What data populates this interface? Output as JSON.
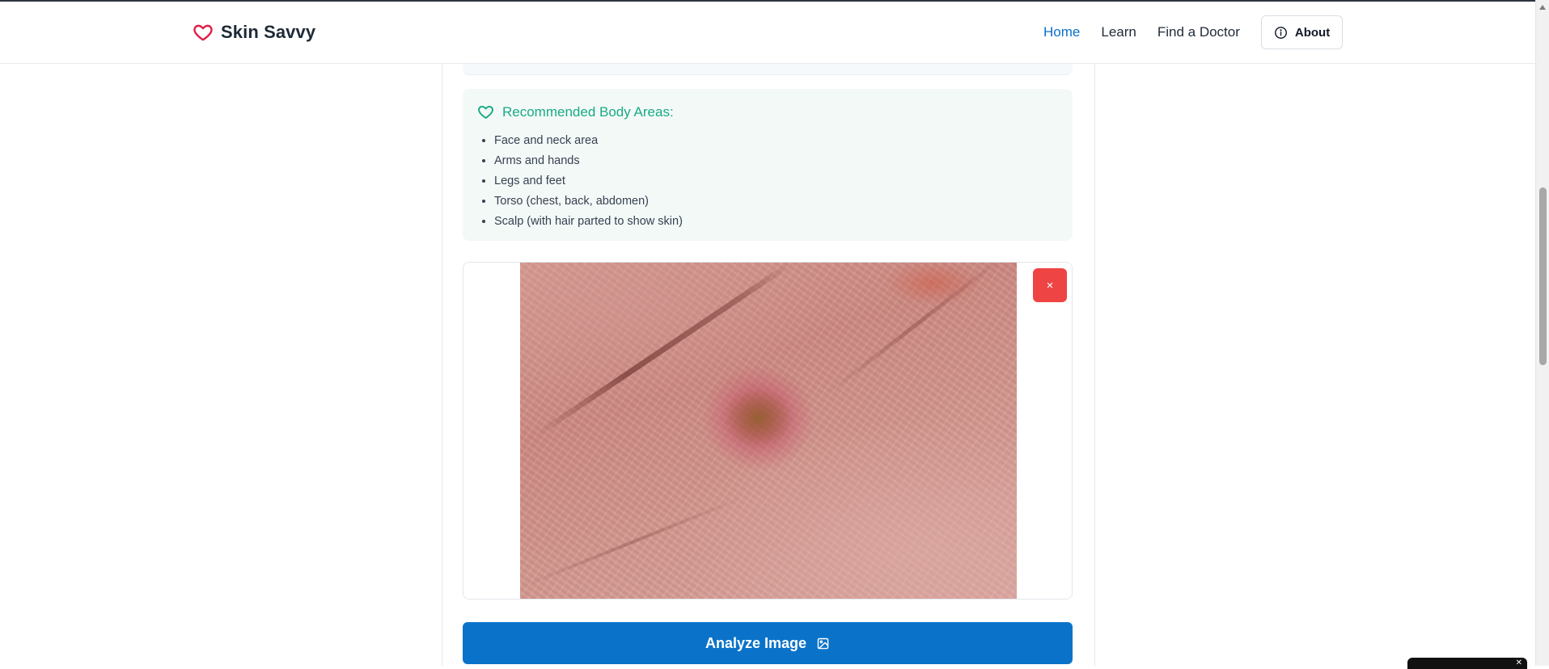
{
  "header": {
    "brand": "Skin Savvy",
    "nav": [
      {
        "label": "Home",
        "active": true
      },
      {
        "label": "Learn",
        "active": false
      },
      {
        "label": "Find a Doctor",
        "active": false
      }
    ],
    "about_label": "About"
  },
  "recommended": {
    "title": "Recommended Body Areas:",
    "items": [
      "Face and neck area",
      "Arms and hands",
      "Legs and feet",
      "Torso (chest, back, abdomen)",
      "Scalp (with hair parted to show skin)"
    ]
  },
  "image_card": {
    "remove_symbol": "×"
  },
  "analyze_label": "Analyze Image",
  "colors": {
    "accent": "#0a73c9",
    "brand_heart": "#e11d48",
    "reco_green": "#1aaa85",
    "danger": "#ef4444"
  }
}
